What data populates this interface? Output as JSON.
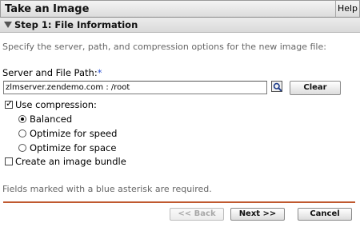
{
  "window": {
    "title": "Take an Image",
    "help_label": "Help"
  },
  "step": {
    "title": "Step 1: File Information"
  },
  "instructions": "Specify the server, path, and compression options for the new image file:",
  "path_field": {
    "label": "Server and File Path:",
    "required_marker": "*",
    "value": "zlmserver.zendemo.com : /root",
    "clear_label": "Clear",
    "search_icon": "search-icon"
  },
  "compression": {
    "checkbox_label": "Use compression:",
    "checked": true,
    "options": [
      {
        "label": "Balanced",
        "selected": true
      },
      {
        "label": "Optimize for speed",
        "selected": false
      },
      {
        "label": "Optimize for space",
        "selected": false
      }
    ]
  },
  "bundle": {
    "checkbox_label": "Create an image bundle",
    "checked": false
  },
  "footnote": "Fields marked with a blue asterisk are required.",
  "footer": {
    "back_label": "<< Back",
    "next_label": "Next >>",
    "cancel_label": "Cancel"
  },
  "colors": {
    "required_asterisk": "#2a4fd1",
    "footer_rule": "#c0592f"
  }
}
